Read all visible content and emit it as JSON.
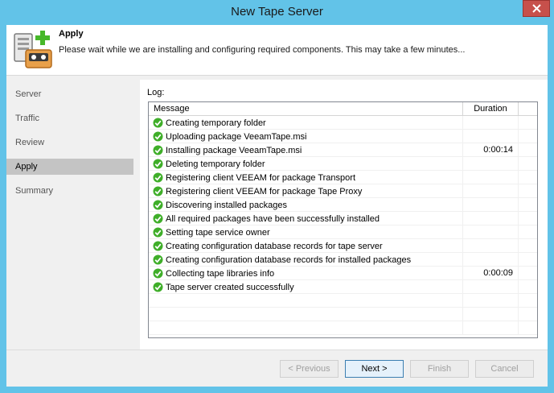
{
  "window": {
    "title": "New Tape Server"
  },
  "header": {
    "title": "Apply",
    "description": "Please wait while we are installing and configuring required components. This may take a few minutes..."
  },
  "sidebar": {
    "items": [
      {
        "label": "Server",
        "active": false
      },
      {
        "label": "Traffic",
        "active": false
      },
      {
        "label": "Review",
        "active": false
      },
      {
        "label": "Apply",
        "active": true
      },
      {
        "label": "Summary",
        "active": false
      }
    ]
  },
  "log": {
    "label": "Log:",
    "columns": {
      "message": "Message",
      "duration": "Duration"
    },
    "rows": [
      {
        "message": "Creating temporary folder",
        "duration": ""
      },
      {
        "message": "Uploading package VeeamTape.msi",
        "duration": ""
      },
      {
        "message": "Installing package VeeamTape.msi",
        "duration": "0:00:14"
      },
      {
        "message": "Deleting temporary folder",
        "duration": ""
      },
      {
        "message": "Registering client VEEAM for package Transport",
        "duration": ""
      },
      {
        "message": "Registering client VEEAM for package Tape Proxy",
        "duration": ""
      },
      {
        "message": "Discovering installed packages",
        "duration": ""
      },
      {
        "message": "All required packages have been successfully installed",
        "duration": ""
      },
      {
        "message": "Setting tape service owner",
        "duration": ""
      },
      {
        "message": "Creating configuration database records for tape server",
        "duration": ""
      },
      {
        "message": "Creating configuration database records for installed packages",
        "duration": ""
      },
      {
        "message": "Collecting tape libraries info",
        "duration": "0:00:09"
      },
      {
        "message": "Tape server created successfully",
        "duration": ""
      }
    ]
  },
  "buttons": {
    "previous": "< Previous",
    "next": "Next >",
    "finish": "Finish",
    "cancel": "Cancel"
  },
  "colors": {
    "titlebar": "#62c3e8",
    "close": "#c7504b",
    "success": "#3fae29"
  }
}
